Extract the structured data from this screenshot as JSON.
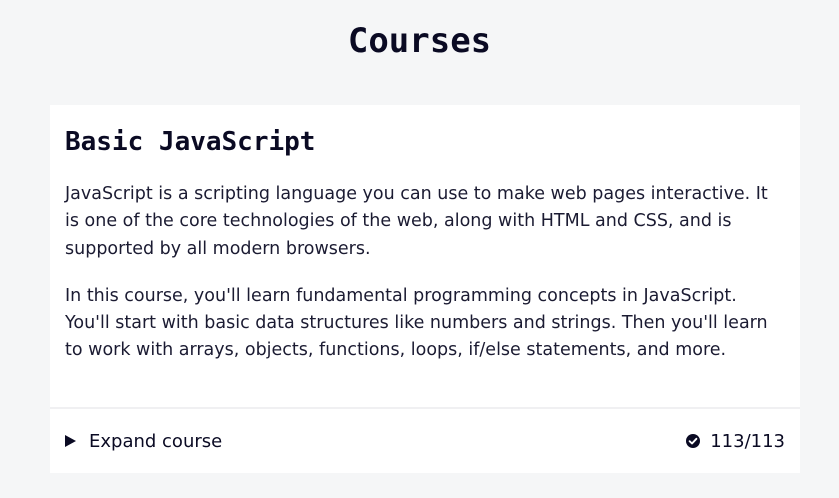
{
  "page": {
    "title": "Courses"
  },
  "course": {
    "title": "Basic JavaScript",
    "description": [
      "JavaScript is a scripting language you can use to make web pages interactive. It is one of the core technologies of the web, along with HTML and CSS, and is supported by all modern browsers.",
      "In this course, you'll learn fundamental programming concepts in JavaScript. You'll start with basic data structures like numbers and strings. Then you'll learn to work with arrays, objects, functions, loops, if/else statements, and more."
    ],
    "expand_label": "Expand course",
    "progress": "113/113",
    "progress_icon": "check-circle-icon"
  },
  "colors": {
    "background": "#f5f6f7",
    "card": "#ffffff",
    "text": "#0a0a23"
  }
}
